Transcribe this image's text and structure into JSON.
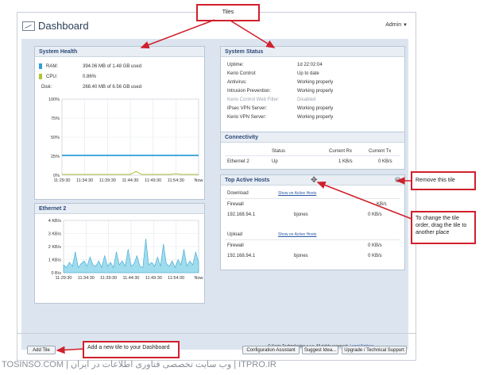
{
  "annotations": {
    "tiles": "Tiles",
    "remove_tile": "Remove this tile",
    "reorder": "To change the tile order, drag the tile to another place",
    "add_tile": "Add a new tile to your Dashboard"
  },
  "header": {
    "title": "Dashboard",
    "user_menu": "Admin",
    "icon": "dashboard-icon"
  },
  "system_health": {
    "title": "System Health",
    "rows": [
      {
        "label": "RAM:",
        "value": "394.06 MB of 1.48 GB used",
        "color": "#2f9fd6"
      },
      {
        "label": "CPU:",
        "value": "0.86%",
        "color": "#b2c13a"
      },
      {
        "label": "Disk:",
        "value": "268.40 MB of 6.56 GB used",
        "color": ""
      }
    ],
    "chart_data": {
      "type": "line",
      "title": "",
      "ylim": [
        0,
        100
      ],
      "y_ticks": [
        "100%",
        "75%",
        "50%",
        "25%",
        "0%"
      ],
      "x_ticks": [
        "11:29:30",
        "11:34:30",
        "11:39:30",
        "11:44:30",
        "11:49:30",
        "11:54:30",
        "Now"
      ],
      "series": [
        {
          "name": "RAM",
          "color": "#2f9fd6",
          "values": [
            26,
            26,
            26,
            26,
            26,
            26,
            26,
            26,
            26,
            26,
            26,
            26,
            26,
            26,
            26,
            26,
            26,
            26,
            26,
            26,
            26,
            26,
            26,
            26,
            26
          ]
        },
        {
          "name": "CPU",
          "color": "#b2c13a",
          "values": [
            1,
            1,
            1,
            1,
            1,
            1,
            1,
            1,
            1,
            1,
            1,
            1,
            1,
            5,
            1,
            1,
            1,
            1,
            1,
            1,
            2,
            1,
            1,
            1,
            1
          ]
        }
      ]
    }
  },
  "ethernet": {
    "title": "Ethernet 2",
    "chart_data": {
      "type": "area",
      "title": "",
      "ylim": [
        0,
        4
      ],
      "y_ticks": [
        "4 KB/s",
        "3 KB/s",
        "2 KB/s",
        "1 KB/s",
        "0 B/s"
      ],
      "x_ticks": [
        "11:29:30",
        "11:34:30",
        "11:39:30",
        "11:44:30",
        "11:49:30",
        "11:54:30",
        "Now"
      ],
      "series": [
        {
          "name": "Rx",
          "color": "#7fd0e8",
          "values": [
            0.6,
            0.4,
            0.8,
            0.5,
            1.6,
            0.4,
            0.7,
            0.9,
            0.5,
            1.2,
            0.6,
            0.5,
            0.9,
            0.4,
            1.3,
            0.5,
            0.8,
            0.4,
            1.6,
            0.6,
            0.9,
            0.5,
            1.8,
            0.5,
            0.7,
            1.3,
            0.5,
            0.4,
            2.6,
            0.6,
            0.8,
            0.5,
            1.2,
            0.5,
            2.2,
            0.7,
            0.5,
            0.9,
            0.4,
            1.0,
            0.6,
            1.8,
            0.5,
            0.9,
            0.6,
            1.6,
            0.8
          ]
        }
      ]
    }
  },
  "system_status": {
    "title": "System Status",
    "rows": [
      {
        "label": "Uptime:",
        "value": "1d 22:02:04",
        "dim": false
      },
      {
        "label": "Kerio Control:",
        "value": "Up to date",
        "dim": false
      },
      {
        "label": "Antivirus:",
        "value": "Working properly",
        "dim": false
      },
      {
        "label": "Intrusion Prevention:",
        "value": "Working properly",
        "dim": false
      },
      {
        "label": "Kerio Control Web Filter:",
        "value": "Disabled",
        "dim": true
      },
      {
        "label": "IPsec VPN Server:",
        "value": "Working properly",
        "dim": false
      },
      {
        "label": "Kerio VPN Server:",
        "value": "Working properly",
        "dim": false
      }
    ]
  },
  "connectivity": {
    "title": "Connectivity",
    "headers": [
      "Status",
      "Current Rx",
      "Current Tx"
    ],
    "rows": [
      {
        "name": "Ethernet 2",
        "status": "Up",
        "rx": "1   KB/s",
        "tx": "0   KB/s"
      }
    ]
  },
  "top_hosts": {
    "title": "Top Active Hosts",
    "download": {
      "label": "Download",
      "link": "Show on Active Hosts",
      "rows": [
        {
          "host": "Firewall",
          "user": "",
          "value": "KB/s"
        },
        {
          "host": "192.168.94.1",
          "user": "bjones",
          "value": "0   KB/s"
        }
      ]
    },
    "upload": {
      "label": "Upload",
      "link": "Show on Active Hosts",
      "rows": [
        {
          "host": "Firewall",
          "user": "",
          "value": "0   KB/s"
        },
        {
          "host": "192.168.94.1",
          "user": "bjones",
          "value": "0   KB/s"
        }
      ]
    }
  },
  "footer": {
    "copyright": "© Kerio Technologies s.r.o. All rights reserved.",
    "legal": "Legal Notices",
    "buttons": {
      "add_tile": "Add Tile",
      "config": "Configuration Assistant",
      "idea": "Suggest Idea...",
      "support": "Upgrade / Technical Support"
    }
  },
  "watermark": {
    "text": "TOSINSO.COM | وب سایت تخصصی فناوری اطلاعات در ایران | ITPRO.IR"
  }
}
